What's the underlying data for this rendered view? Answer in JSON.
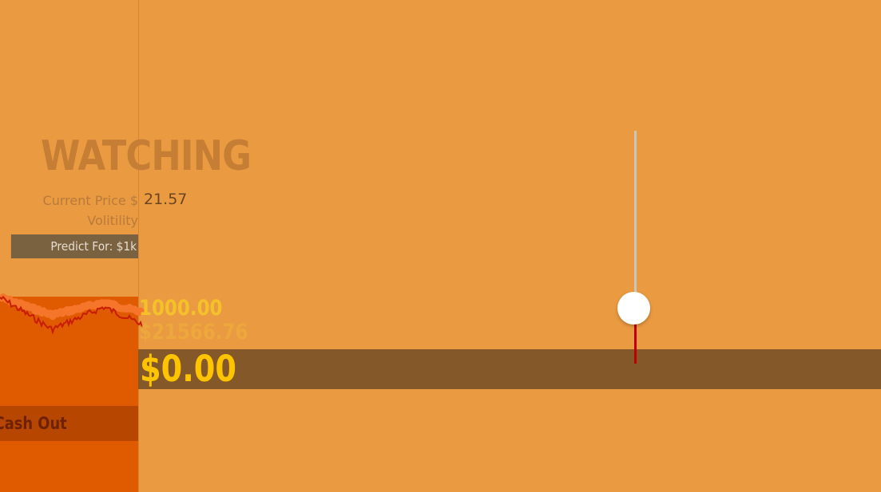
{
  "status": {
    "title": "WATCHING"
  },
  "stats": {
    "current_price_label": "Current Price $",
    "current_price_value": "21.57",
    "volatility_label": "Volitility"
  },
  "predict": {
    "label": "Predict For: $1k"
  },
  "amounts": {
    "bet": "1000.00",
    "target": "$21566.76",
    "balance": "$0.00"
  },
  "cashout": {
    "label": "Cash Out"
  },
  "price_chart": {
    "line_color": "#c81e00",
    "band_color": "#f5762a",
    "fill_color": "#e05a00"
  },
  "slider": {
    "level": 0.71
  },
  "colors": {
    "background": "#ea9b41",
    "balance_bar": "#845828",
    "balance_text": "#ffc400",
    "cashout_bg": "#b64600"
  }
}
